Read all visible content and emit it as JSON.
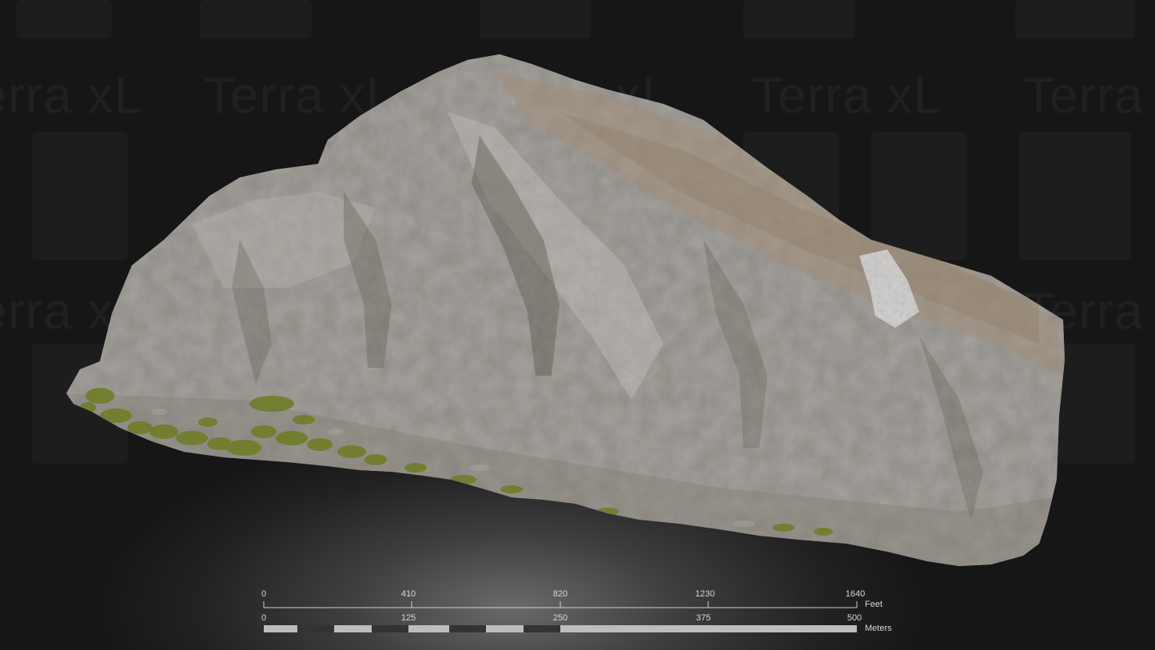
{
  "image": {
    "description_tag": "3d-rock-model",
    "watermark_text": "Terra xL"
  },
  "scale_bar": {
    "feet": {
      "ticks": [
        "0",
        "410",
        "820",
        "1230",
        "1640"
      ],
      "unit": "Feet"
    },
    "meters": {
      "ticks": [
        "0",
        "125",
        "250",
        "375",
        "500"
      ],
      "unit": "Meters"
    }
  },
  "colors": {
    "background": "#161616",
    "rock_base": "#a8a6a3",
    "rock_shadow": "#6f6a63",
    "vegetation": "#6b7a2a",
    "scale_line": "#d0d0d0",
    "scale_dark": "#333333",
    "scale_light": "#bdbdbd"
  }
}
